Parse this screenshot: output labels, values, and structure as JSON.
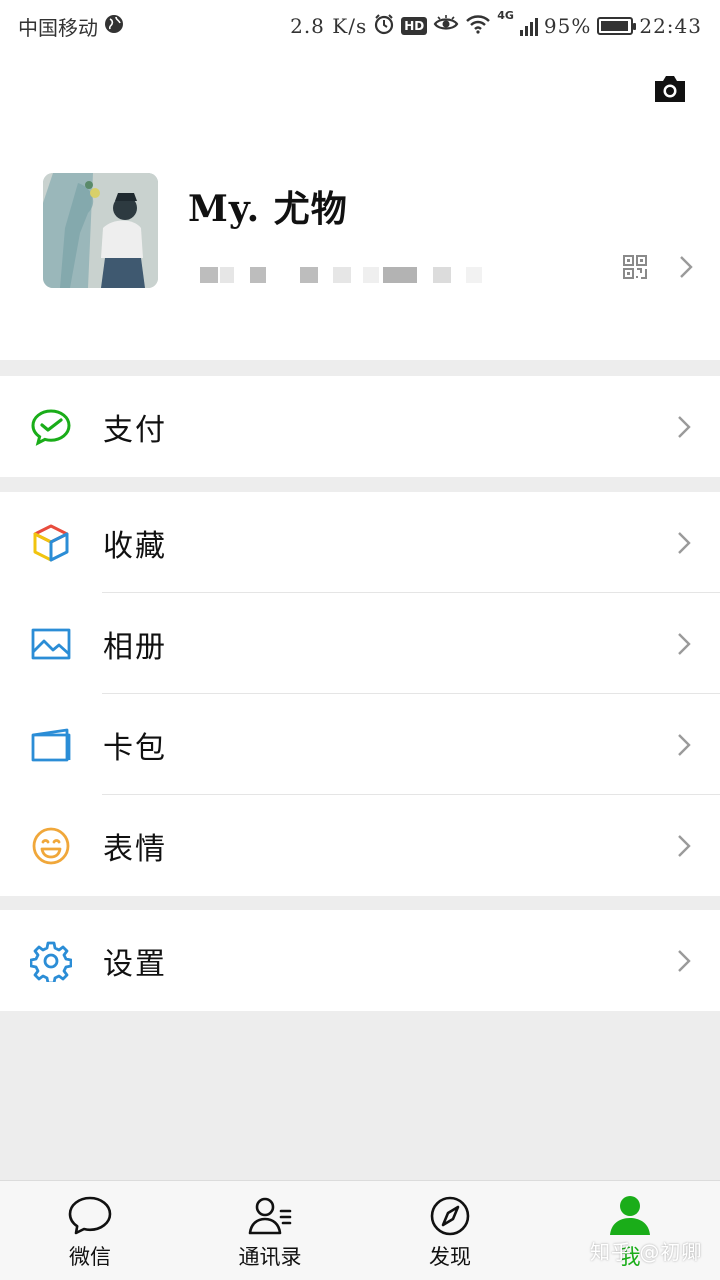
{
  "status_bar": {
    "carrier": "中国移动",
    "speed": "2.8 K/s",
    "hd": "HD",
    "network": "4G",
    "battery_percent": "95%",
    "battery_level": 0.95,
    "time": "22:43"
  },
  "profile": {
    "nickname": "My. 尤物"
  },
  "menu_groups": [
    [
      {
        "label": "支付",
        "icon": "wechat-pay-icon"
      }
    ],
    [
      {
        "label": "收藏",
        "icon": "favorites-cube-icon"
      },
      {
        "label": "相册",
        "icon": "album-picture-icon"
      },
      {
        "label": "卡包",
        "icon": "card-wallet-icon"
      },
      {
        "label": "表情",
        "icon": "smiley-face-icon"
      }
    ],
    [
      {
        "label": "设置",
        "icon": "gear-icon"
      }
    ]
  ],
  "tabbar": [
    {
      "label": "微信",
      "icon": "chat-bubble-icon",
      "active": false
    },
    {
      "label": "通讯录",
      "icon": "contacts-icon",
      "active": false
    },
    {
      "label": "发现",
      "icon": "compass-icon",
      "active": false
    },
    {
      "label": "我",
      "icon": "person-icon",
      "active": true
    }
  ],
  "watermark": "知乎 @初卿",
  "colors": {
    "accent_green": "#1aad19",
    "background": "#ededed",
    "pay_green": "#1aad19",
    "album_blue": "#2b8dd6",
    "card_blue": "#2b8dd6",
    "smiley_orange": "#f0a73a",
    "gear_blue": "#2b8dd6"
  }
}
